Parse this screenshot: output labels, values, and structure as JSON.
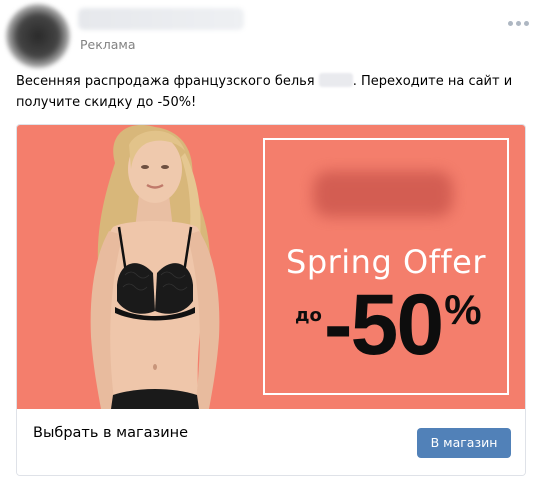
{
  "post": {
    "sponsored_label": "Реклама",
    "text_before": "Весенняя распродажа французского белья ",
    "text_after": ". Переходите на сайт и получите скидку до -50%!"
  },
  "ad": {
    "offer_title": "Spring Offer",
    "discount_prefix": "до",
    "discount_value": "-50",
    "discount_percent": "%",
    "background_color": "#f47e6c"
  },
  "card": {
    "title": "Выбрать в магазине",
    "button_label": "В магазин",
    "button_color": "#5181b8"
  },
  "icons": {
    "more": "more-dots-icon"
  }
}
